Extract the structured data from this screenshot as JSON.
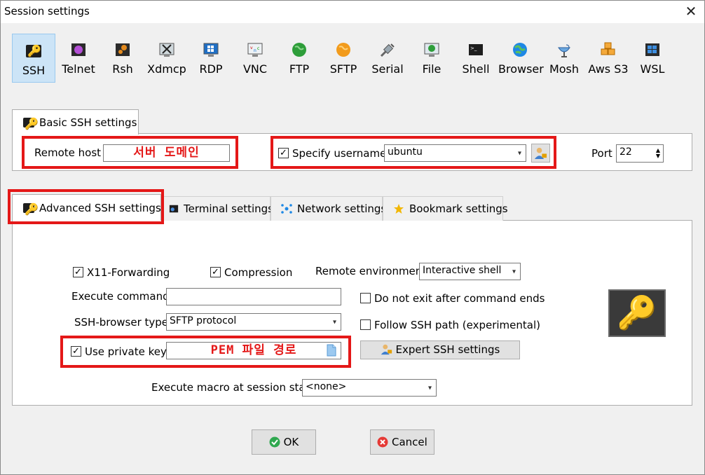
{
  "window": {
    "title": "Session settings",
    "close_glyph": "✕"
  },
  "protocols": [
    {
      "label": "SSH",
      "icon": "ssh-key-icon",
      "selected": true
    },
    {
      "label": "Telnet",
      "icon": "telnet-icon"
    },
    {
      "label": "Rsh",
      "icon": "rsh-icon"
    },
    {
      "label": "Xdmcp",
      "icon": "xdmcp-icon"
    },
    {
      "label": "RDP",
      "icon": "rdp-icon"
    },
    {
      "label": "VNC",
      "icon": "vnc-icon"
    },
    {
      "label": "FTP",
      "icon": "ftp-globe-icon"
    },
    {
      "label": "SFTP",
      "icon": "sftp-globe-icon"
    },
    {
      "label": "Serial",
      "icon": "serial-plug-icon"
    },
    {
      "label": "File",
      "icon": "file-icon"
    },
    {
      "label": "Shell",
      "icon": "shell-terminal-icon"
    },
    {
      "label": "Browser",
      "icon": "browser-globe-icon"
    },
    {
      "label": "Mosh",
      "icon": "mosh-satellite-icon"
    },
    {
      "label": "Aws S3",
      "icon": "aws-s3-cubes-icon"
    },
    {
      "label": "WSL",
      "icon": "wsl-windows-icon"
    }
  ],
  "basic": {
    "tab_label": "Basic SSH settings",
    "remote_host_label": "Remote host *",
    "remote_host_value": "서버 도메인",
    "specify_username_label": "Specify username",
    "specify_username_checked": true,
    "username_value": "ubuntu",
    "port_label": "Port",
    "port_value": "22"
  },
  "tabs": [
    {
      "label": "Advanced SSH settings",
      "icon": "key-icon",
      "active": true
    },
    {
      "label": "Terminal settings",
      "icon": "terminal-icon"
    },
    {
      "label": "Network settings",
      "icon": "network-icon"
    },
    {
      "label": "Bookmark settings",
      "icon": "star-icon"
    }
  ],
  "advanced": {
    "x11_label": "X11-Forwarding",
    "x11_checked": true,
    "compression_label": "Compression",
    "compression_checked": true,
    "remote_env_label": "Remote environment:",
    "remote_env_value": "Interactive shell",
    "execute_command_label": "Execute command:",
    "execute_command_value": "",
    "do_not_exit_label": "Do not exit after command ends",
    "do_not_exit_checked": false,
    "ssh_browser_label": "SSH-browser type:",
    "ssh_browser_value": "SFTP protocol",
    "follow_ssh_label": "Follow SSH path (experimental)",
    "follow_ssh_checked": false,
    "use_private_key_label": "Use private key",
    "use_private_key_checked": true,
    "private_key_value": "PEM 파일 경로",
    "expert_button_label": "Expert SSH settings",
    "macro_label": "Execute macro at session start:",
    "macro_value": "<none>"
  },
  "footer": {
    "ok_label": "OK",
    "cancel_label": "Cancel"
  },
  "colors": {
    "highlight_red": "#e41818",
    "selected_bg": "#cce4f7"
  }
}
